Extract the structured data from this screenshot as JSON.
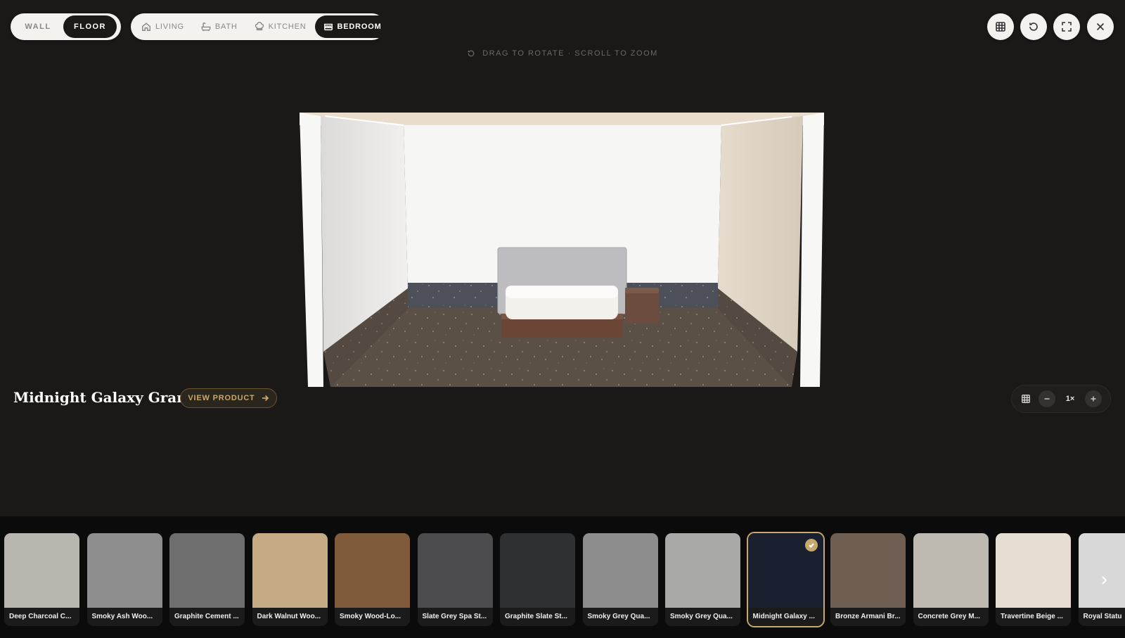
{
  "mode_toggle": {
    "items": [
      "WALL",
      "FLOOR"
    ],
    "active": "FLOOR"
  },
  "room_toggle": {
    "items": [
      {
        "label": "LIVING",
        "icon": "home-icon"
      },
      {
        "label": "BATH",
        "icon": "bathtub-icon"
      },
      {
        "label": "KITCHEN",
        "icon": "chef-hat-icon"
      },
      {
        "label": "BEDROOM",
        "icon": "bed-icon"
      }
    ],
    "active": "BEDROOM"
  },
  "toolbar": {
    "icons": [
      "grid-icon",
      "reset-icon",
      "fullscreen-icon",
      "close-icon"
    ]
  },
  "hint": {
    "text": "DRAG TO ROTATE · SCROLL TO ZOOM",
    "icon": "rotate-icon"
  },
  "product": {
    "title": "Midnight Galaxy Granite",
    "view_label": "VIEW PRODUCT"
  },
  "zoom": {
    "value": "1×"
  },
  "materials": [
    {
      "label": "Deep Charcoal C...",
      "color": "#b9b6af"
    },
    {
      "label": "Smoky Ash Woo...",
      "color": "#8e8e8e"
    },
    {
      "label": "Graphite Cement ...",
      "color": "#6e6e6e"
    },
    {
      "label": "Dark Walnut Woo...",
      "color": "#c4ab85"
    },
    {
      "label": "Smoky Wood-Lo...",
      "color": "#7f5a3b"
    },
    {
      "label": "Slate Grey Spa St...",
      "color": "#4b4b4d"
    },
    {
      "label": "Graphite Slate St...",
      "color": "#2f3031"
    },
    {
      "label": "Smoky Grey Qua...",
      "color": "#8d8d8e"
    },
    {
      "label": "Smoky Grey Qua...",
      "color": "#a9aaa8"
    },
    {
      "label": "Midnight Galaxy ...",
      "color": "#1a2030",
      "selected": true
    },
    {
      "label": "Bronze Armani Br...",
      "color": "#6f5e52"
    },
    {
      "label": "Concrete Grey M...",
      "color": "#bdb9b1"
    },
    {
      "label": "Travertine Beige ...",
      "color": "#e6ddd3"
    },
    {
      "label": "Royal Statu",
      "color": "#d8d8d8"
    }
  ],
  "colors": {
    "accent": "#c9a86b",
    "background": "#1a1918"
  }
}
